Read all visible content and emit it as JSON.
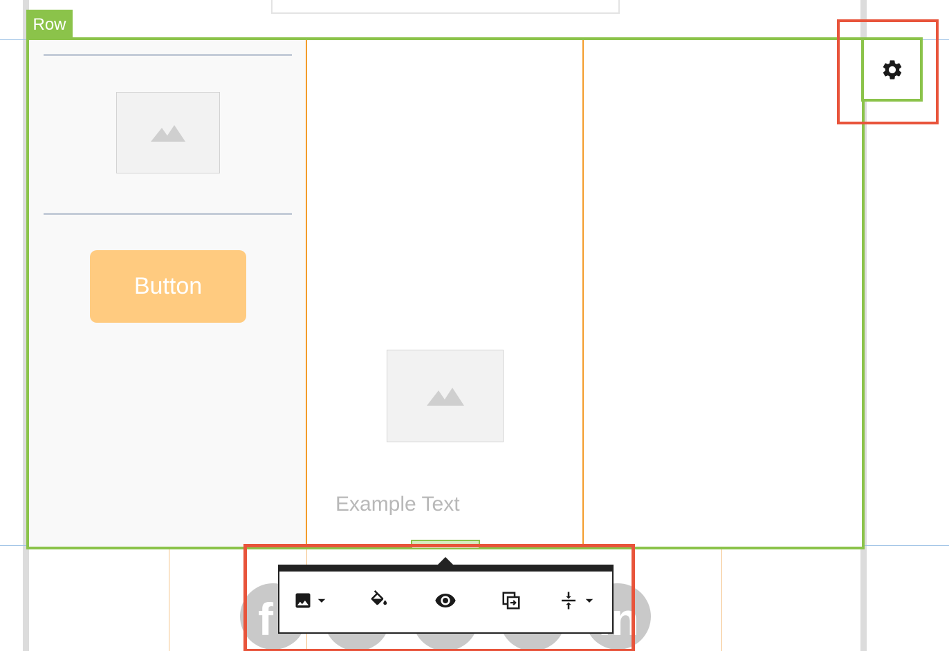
{
  "row": {
    "tag_label": "Row"
  },
  "column1": {
    "button_label": "Button"
  },
  "column2": {
    "example_text": "Example Text"
  },
  "social": {
    "left_letter": "f",
    "right_letter": "in"
  },
  "toolbar": {
    "items": [
      {
        "name": "image-icon",
        "has_dropdown": true
      },
      {
        "name": "paint-bucket-icon",
        "has_dropdown": false
      },
      {
        "name": "eye-icon",
        "has_dropdown": false
      },
      {
        "name": "duplicate-icon",
        "has_dropdown": false
      },
      {
        "name": "vertical-align-icon",
        "has_dropdown": true
      }
    ]
  },
  "settings": {
    "icon": "gear-icon"
  },
  "colors": {
    "row_outline": "#8bc34a",
    "highlight": "#e8543b",
    "column_divider": "#f39c2b",
    "button_bg": "#ffcb80",
    "toolbar_dark": "#222222"
  }
}
